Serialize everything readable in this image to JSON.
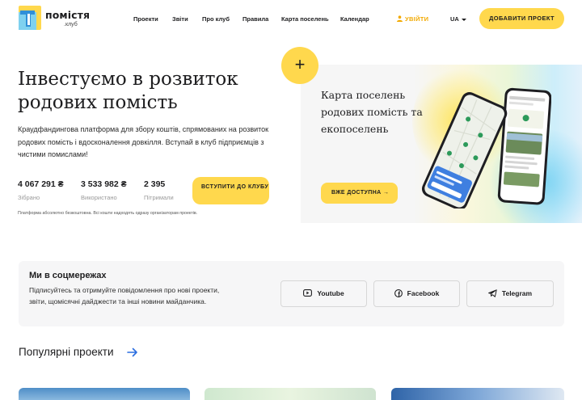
{
  "brand": {
    "title": "помістя",
    "subtitle": ".клуб"
  },
  "nav": {
    "items": [
      {
        "label": "Проекти"
      },
      {
        "label": "Звіти"
      },
      {
        "label": "Про клуб"
      },
      {
        "label": "Правила"
      },
      {
        "label": "Карта поселень"
      },
      {
        "label": "Календар"
      }
    ],
    "login_label": "УВІЙТИ",
    "language": "UA",
    "add_project_label": "ДОБАВИТИ ПРОЕКТ"
  },
  "hero": {
    "title": "Інвестуємо в розвиток родових помість",
    "description": "Краудфандингова платформа для збору коштів, спрямованих на розвиток родових помість і вдосконалення довкілля. Вступай в клуб підприємців з чистими помислами!",
    "stats": [
      {
        "value": "4 067 291 ₴",
        "label": "Зібрано"
      },
      {
        "value": "3 533 982 ₴",
        "label": "Використано"
      },
      {
        "value": "2 395",
        "label": "Пітримали"
      }
    ],
    "join_label": "ВСТУПИТИ ДО КЛУБУ",
    "note": "Платформа абсолютно безкоштовна. Всі кошти надходять одразу організаторам проектів."
  },
  "map_card": {
    "plus_label": "+",
    "title": "Карта поселень родових помість та екопоселень",
    "button_label": "ВЖЕ ДОСТУПНА →"
  },
  "social": {
    "title": "Ми в соцмережах",
    "description": "Підписуйтесь та отримуйте повідомлення про нові проекти, звіти, щомісячні дайджести та інші новини майданчика.",
    "buttons": [
      {
        "label": "Youtube",
        "icon": "youtube-icon"
      },
      {
        "label": "Facebook",
        "icon": "facebook-icon"
      },
      {
        "label": "Telegram",
        "icon": "telegram-icon"
      }
    ]
  },
  "popular": {
    "title": "Популярні проекти"
  },
  "colors": {
    "accent": "#ffd84d",
    "login": "#f2a900",
    "link_arrow": "#2b6ee0",
    "text": "#1d1d1f"
  }
}
